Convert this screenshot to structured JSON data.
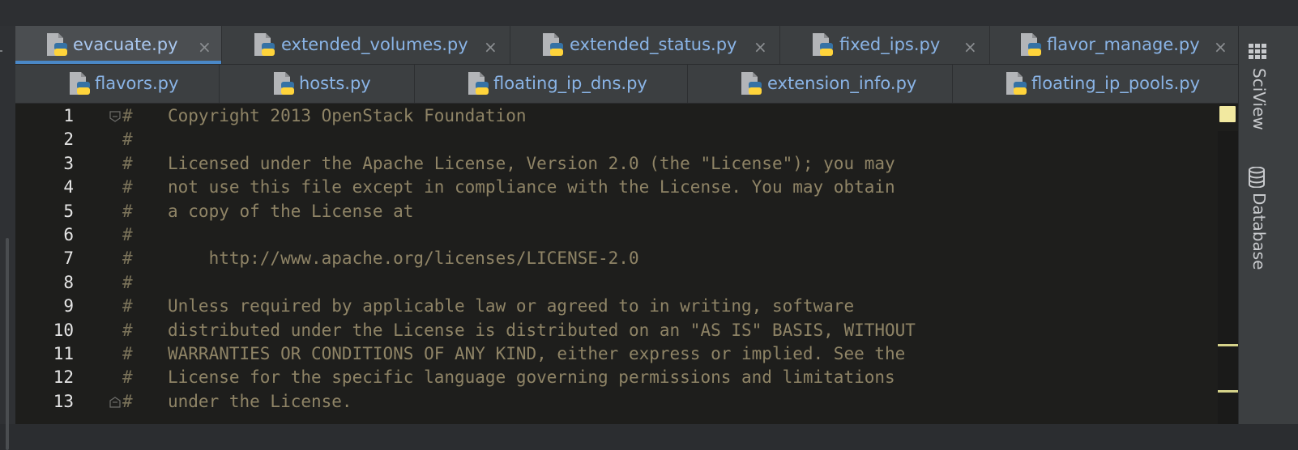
{
  "tabs_row1": [
    {
      "label": "evacuate.py",
      "active": true
    },
    {
      "label": "extended_volumes.py",
      "active": false
    },
    {
      "label": "extended_status.py",
      "active": false
    },
    {
      "label": "fixed_ips.py",
      "active": false
    },
    {
      "label": "flavor_manage.py",
      "active": false
    }
  ],
  "tabs_row2": [
    {
      "label": "flavors.py"
    },
    {
      "label": "hosts.py"
    },
    {
      "label": "floating_ip_dns.py"
    },
    {
      "label": "extension_info.py"
    },
    {
      "label": "floating_ip_pools.py"
    }
  ],
  "tab_close_glyph": "×",
  "editor": {
    "comment_char": "#",
    "lines": [
      {
        "n": "1",
        "text": "Copyright 2013 OpenStack Foundation"
      },
      {
        "n": "2",
        "text": ""
      },
      {
        "n": "3",
        "text": "Licensed under the Apache License, Version 2.0 (the \"License\"); you may"
      },
      {
        "n": "4",
        "text": "not use this file except in compliance with the License. You may obtain"
      },
      {
        "n": "5",
        "text": "a copy of the License at"
      },
      {
        "n": "6",
        "text": ""
      },
      {
        "n": "7",
        "text": "    http://www.apache.org/licenses/LICENSE-2.0"
      },
      {
        "n": "8",
        "text": ""
      },
      {
        "n": "9",
        "text": "Unless required by applicable law or agreed to in writing, software"
      },
      {
        "n": "10",
        "text": "distributed under the License is distributed on an \"AS IS\" BASIS, WITHOUT"
      },
      {
        "n": "11",
        "text": "WARRANTIES OR CONDITIONS OF ANY KIND, either express or implied. See the"
      },
      {
        "n": "12",
        "text": "License for the specific language governing permissions and limitations"
      },
      {
        "n": "13",
        "text": "under the License."
      }
    ]
  },
  "right_panel": {
    "sciview_label": "SciView",
    "database_label": "Database"
  },
  "colors": {
    "accent": "#4a88c7",
    "tab_text": "#8ab4e6",
    "comment": "#8f8466",
    "editor_bg": "#1e1e1c"
  },
  "icons": {
    "file_tab": "python-file-icon",
    "close": "close-icon",
    "fold": "fold-marker-icon",
    "sciview": "grid-icon",
    "database": "database-icon",
    "inspection": "warning-square-icon"
  }
}
